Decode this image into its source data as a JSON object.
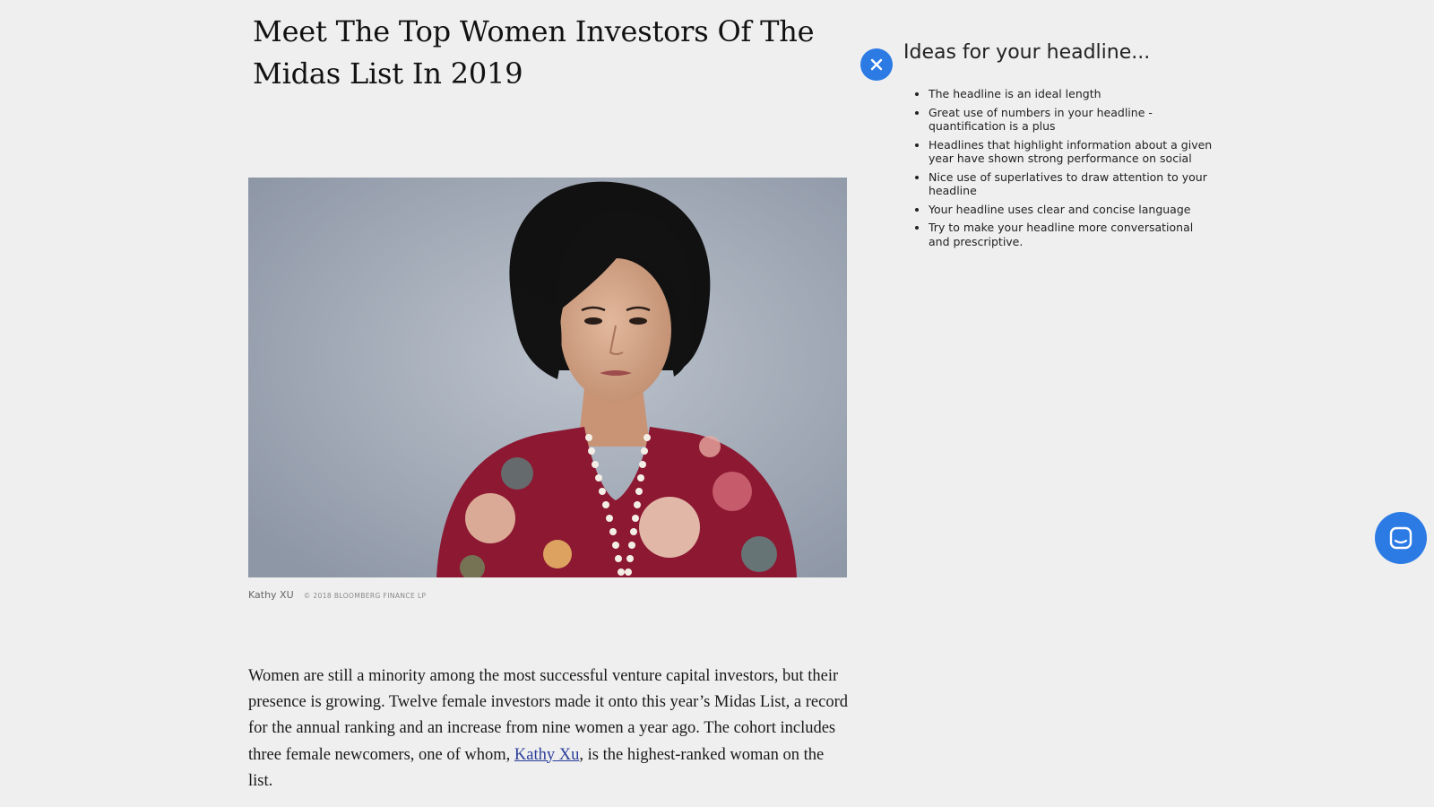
{
  "article": {
    "headline": "Meet The Top Women Investors Of The Midas List In 2019",
    "image": {
      "caption_name": "Kathy XU",
      "caption_credit": "© 2018 BLOOMBERG FINANCE LP"
    },
    "body": {
      "before_link": "Women are still a minority among the most successful venture capital investors, but their presence is growing. Twelve female investors made it onto this year’s Midas List, a record for the annual ranking and an increase from nine women a year ago. The cohort includes three female newcomers, one of whom, ",
      "link_text": "Kathy Xu",
      "after_link": ", is the highest-ranked woman on the list."
    }
  },
  "headline_panel": {
    "title": "Ideas for your headline...",
    "close_icon": "close-icon",
    "tips": [
      "The headline is an ideal length",
      "Great use of numbers in your headline - quantification is a plus",
      "Headlines that highlight information about a given year have shown strong performance on social",
      "Nice use of superlatives to draw attention to your headline",
      "Your headline uses clear and concise language",
      "Try to make your headline more conversational and prescriptive."
    ]
  },
  "chat_widget": {
    "icon": "chat-icon"
  },
  "colors": {
    "accent": "#2c7be5",
    "background": "#efefef",
    "link": "#2a3d9a"
  }
}
